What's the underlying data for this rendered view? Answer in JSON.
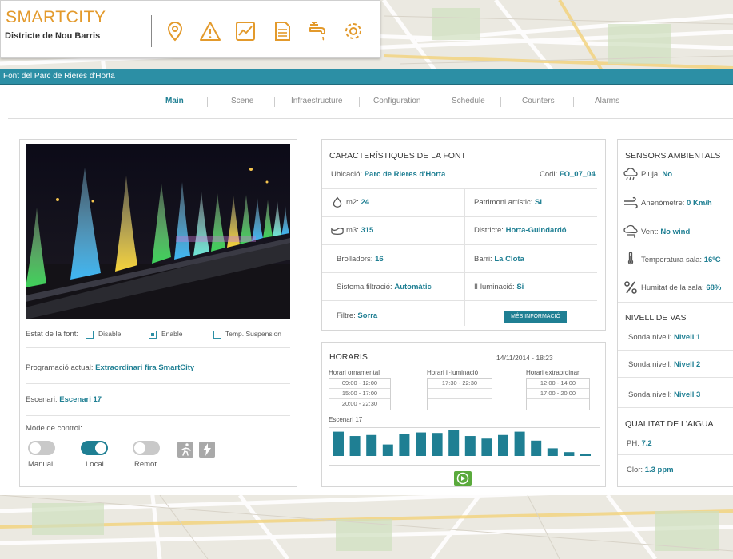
{
  "brand": {
    "title": "SMARTCITY",
    "subtitle": "Districte de Nou Barris"
  },
  "toolbar_icons": [
    "location-pin-icon",
    "warning-icon",
    "line-chart-icon",
    "document-icon",
    "water-tap-icon",
    "settings-gear-icon"
  ],
  "window_title": "Font del Parc de Rieres d'Horta",
  "tabs": [
    {
      "label": "Main",
      "active": true
    },
    {
      "label": "Scene"
    },
    {
      "label": "Infraestructure"
    },
    {
      "label": "Configuration"
    },
    {
      "label": "Schedule"
    },
    {
      "label": "Counters"
    },
    {
      "label": "Alarms"
    }
  ],
  "left": {
    "estat_label": "Estat de la font:",
    "estat_options": [
      {
        "label": "Disable",
        "checked": false
      },
      {
        "label": "Enable",
        "checked": true
      },
      {
        "label": "Temp. Suspension",
        "checked": false
      }
    ],
    "programacio_label": "Programació actual:",
    "programacio_value": "Extraordinari fira SmartCity",
    "escenari_label": "Escenari:",
    "escenari_value": "Escenari 17",
    "mode_label": "Mode de control:",
    "modes": [
      {
        "label": "Manual",
        "on": false
      },
      {
        "label": "Local",
        "on": true
      },
      {
        "label": "Remot",
        "on": false
      }
    ]
  },
  "caract": {
    "title": "CARACTERÍSTIQUES DE LA FONT",
    "ubicacio_label": "Ubicació:",
    "ubicacio_value": "Parc de Rieres d'Horta",
    "codi_label": "Codi:",
    "codi_value": "FO_07_04",
    "m2_label": "m2:",
    "m2_value": "24",
    "m3_label": "m3:",
    "m3_value": "315",
    "brolladors_label": "Brolladors:",
    "brolladors_value": "16",
    "sistema_label": "Sistema filtració:",
    "sistema_value": "Automàtic",
    "filtre_label": "Filtre:",
    "filtre_value": "Sorra",
    "patrimoni_label": "Patrimoni artístic:",
    "patrimoni_value": "Si",
    "districte_label": "Districte:",
    "districte_value": "Horta-Guindardó",
    "barri_label": "Barri:",
    "barri_value": "La Clota",
    "illuminacio_label": "Il·luminació:",
    "illuminacio_value": "Si",
    "more_button": "MÉS INFORMACIÓ"
  },
  "horaris": {
    "title": "HORARIS",
    "datetime": "14/11/2014 - 18:23",
    "col1_title": "Horari ornamental",
    "col1_rows": [
      "09:00 - 12:00",
      "15:00 - 17:00",
      "20:00 - 22:30"
    ],
    "col2_title": "Horari il·luminació",
    "col2_rows": [
      "17:30 - 22:30",
      "",
      ""
    ],
    "col3_title": "Horari extraordinari",
    "col3_rows": [
      "12:00 - 14:00",
      "17:00 - 20:00",
      ""
    ],
    "chart_label": "Escenari 17",
    "colors": {
      "bars": "#1f7f93",
      "play": "#5aaa3c"
    },
    "bar_levels": [
      0.95,
      0.78,
      0.82,
      0.45,
      0.85,
      0.92,
      0.9,
      1.0,
      0.78,
      0.68,
      0.82,
      0.95,
      0.6,
      0.3,
      0.15,
      0.08
    ]
  },
  "sensors": {
    "title": "SENSORS AMBIENTALS",
    "items": [
      {
        "icon": "rain-cloud-icon",
        "label": "Pluja:",
        "value": "No"
      },
      {
        "icon": "anemometer-icon",
        "label": "Anenòmetre:",
        "value": "0 Km/h"
      },
      {
        "icon": "wind-icon",
        "label": "Vent:",
        "value": "No wind"
      },
      {
        "icon": "thermometer-icon",
        "label": "Temperatura sala:",
        "value": "16ºC"
      },
      {
        "icon": "humidity-icon",
        "label": "Humitat de la sala:",
        "value": "68%"
      }
    ],
    "nivell_title": "NIVELL DE VAS",
    "nivell_items": [
      {
        "label": "Sonda nivell:",
        "value": "Nivell 1"
      },
      {
        "label": "Sonda nivell:",
        "value": "Nivell 2"
      },
      {
        "label": "Sonda nivell:",
        "value": "Nivell 3"
      }
    ],
    "qualitat_title": "QUALITAT DE L'AIGUA",
    "ph_label": "PH:",
    "ph_value": "7.2",
    "clor_label": "Clor:",
    "clor_value": "1.3 ppm"
  }
}
